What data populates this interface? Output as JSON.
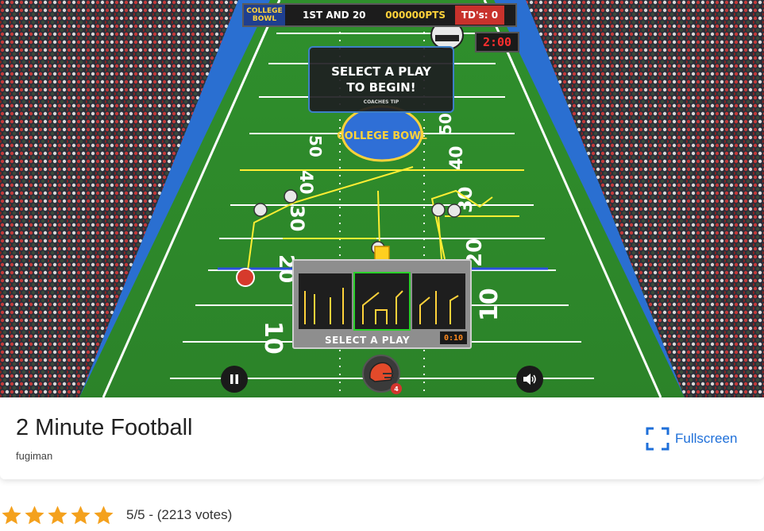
{
  "game": {
    "hud": {
      "logo_line1": "COLLEGE",
      "logo_line2": "BOWL",
      "down_distance": "1ST AND 20",
      "points": "000000PTS",
      "touchdowns": "TD's: 0"
    },
    "clock": "2:00",
    "coach_tip": {
      "message": "SELECT A PLAY TO BEGIN!",
      "caption": "COACHES TIP"
    },
    "play_select": {
      "label": "SELECT A PLAY",
      "timer": "0:10",
      "selected_index": 1
    },
    "yard_numbers": [
      "50",
      "40",
      "30",
      "20",
      "10"
    ],
    "midfield_logo": "COLLEGE BOWL",
    "helmet_badge": "4",
    "icons": {
      "pause": "pause-icon",
      "sound": "speaker-icon",
      "helmet": "helmet-icon",
      "fullscreen": "fullscreen-icon",
      "star": "star-icon"
    },
    "colors": {
      "field": "#2f8a2c",
      "stands": "#2a6fd1",
      "route": "#ffee33",
      "clock": "#ff2e2e"
    }
  },
  "info": {
    "title": "2 Minute Football",
    "author": "fugiman",
    "fullscreen_label": "Fullscreen"
  },
  "rating": {
    "stars": 5,
    "text": "5/5 - (2213 votes)"
  }
}
